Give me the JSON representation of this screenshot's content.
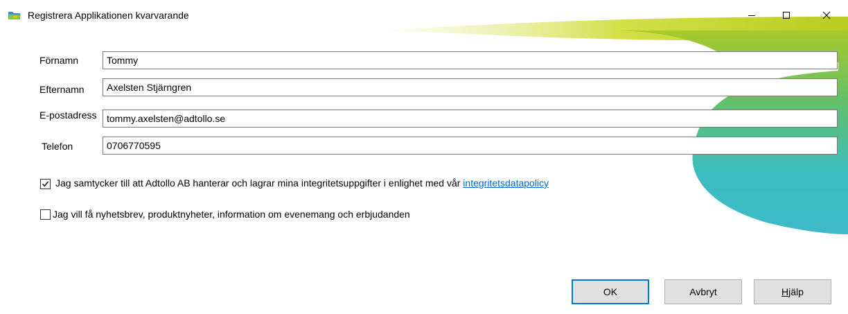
{
  "window": {
    "title": "Registrera Applikationen kvarvarande",
    "minimize_icon": "minimize-icon",
    "maximize_icon": "maximize-icon",
    "close_icon": "close-icon"
  },
  "form": {
    "first_name": {
      "label": "Förnamn",
      "value": "Tommy"
    },
    "last_name": {
      "label": "Efternamn",
      "value": "Axelsten Stjärngren"
    },
    "email": {
      "label": "E-postadress",
      "value": "tommy.axelsten@adtollo.se"
    },
    "phone": {
      "label": "Telefon",
      "value": "0706770595"
    }
  },
  "consent": {
    "checked": true,
    "text": "Jag samtycker till att Adtollo AB hanterar och lagrar mina integritetsuppgifter i enlighet med vår ",
    "link_text": "integritetsdatapolicy"
  },
  "newsletter": {
    "checked": false,
    "text": "Jag vill få nyhetsbrev, produktnyheter, information om evenemang och erbjudanden"
  },
  "buttons": {
    "ok": "OK",
    "cancel": "Avbryt",
    "help_underlined": "H",
    "help_rest": "jälp"
  },
  "colors": {
    "accent": "#0078d7",
    "link": "#0066cc",
    "deco_green": "#c4d82a",
    "deco_teal": "#3bbdc0"
  }
}
